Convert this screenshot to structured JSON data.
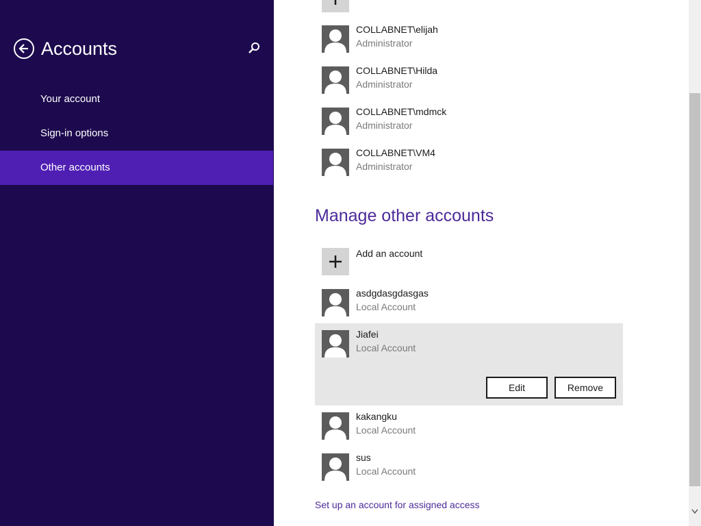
{
  "window": {
    "title": "Accounts"
  },
  "left_pane": {
    "back_icon": "back-arrow-icon",
    "search_icon": "search-icon",
    "nav_items": [
      {
        "label": "Your account",
        "selected": false
      },
      {
        "label": "Sign-in options",
        "selected": false
      },
      {
        "label": "Other accounts",
        "selected": true
      }
    ],
    "colors": {
      "background": "#1d0a4e",
      "selected": "#4f1fb3"
    }
  },
  "right_pane": {
    "domain_accounts": [
      {
        "name": "COLLABNET\\elijah",
        "type": "Administrator"
      },
      {
        "name": "COLLABNET\\Hilda",
        "type": "Administrator"
      },
      {
        "name": "COLLABNET\\mdmck",
        "type": "Administrator"
      },
      {
        "name": "COLLABNET\\VM4",
        "type": "Administrator"
      }
    ],
    "section_title": "Manage other accounts",
    "add_account_label": "Add an account",
    "other_accounts": [
      {
        "name": "asdgdasgdasgas",
        "type": "Local Account"
      },
      {
        "name": "Jiafei",
        "type": "Local Account",
        "selected": true
      },
      {
        "name": "kakangku",
        "type": "Local Account"
      },
      {
        "name": "sus",
        "type": "Local Account"
      }
    ],
    "edit_label": "Edit",
    "remove_label": "Remove",
    "assigned_access_link": "Set up an account for assigned access",
    "colors": {
      "accent": "#4c2a99",
      "selected_panel": "#e6e6e6"
    }
  }
}
